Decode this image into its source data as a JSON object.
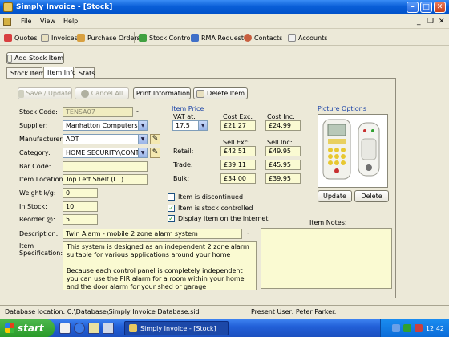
{
  "window": {
    "title": "Simply Invoice - [Stock]"
  },
  "menu": {
    "file": "File",
    "view": "View",
    "help": "Help"
  },
  "toolbar": {
    "quotes": "Quotes",
    "invoices": "Invoices",
    "purchase_orders": "Purchase Orders",
    "stock_control": "Stock Control",
    "rma": "RMA Request",
    "contacts": "Contacts",
    "accounts": "Accounts"
  },
  "add_stock_item": "Add Stock Item",
  "tabs": {
    "stock_items": "Stock Items",
    "item_info": "Item Info",
    "stats": "Stats"
  },
  "actions": {
    "save": "Save / Update",
    "cancel": "Cancel All",
    "print": "Print Information",
    "delete": "Delete Item"
  },
  "labels": {
    "stock_code": "Stock Code:",
    "supplier": "Supplier:",
    "manufacturer": "Manufacturer:",
    "category": "Category:",
    "bar_code": "Bar Code:",
    "item_location": "Item Location:",
    "weight": "Weight k/g:",
    "in_stock": "In Stock:",
    "reorder": "Reorder @:",
    "description": "Description:",
    "specification": "Item Specification:"
  },
  "values": {
    "stock_code": "TENSA07",
    "supplier": "Manhatton Computers",
    "manufacturer": "ADT",
    "category": "HOME SECURITY\\CONT",
    "bar_code": "",
    "item_location": "Top Left Shelf (L1)",
    "weight": "0",
    "in_stock": "10",
    "reorder": "5",
    "description": "Twin Alarm - mobile 2 zone alarm system",
    "spec_p1": "This system is designed as an independent 2 zone alarm suitable for various applications around your home",
    "spec_p2": "Because each control panel is completely independent you can use the PIR alarm for a room within your home and the door alarm for your shed or garage"
  },
  "price": {
    "group": "Item Price",
    "vat_label": "VAT at:",
    "vat_value": "17.5",
    "cost_exc_label": "Cost Exc:",
    "cost_inc_label": "Cost Inc:",
    "cost_exc": "£21.27",
    "cost_inc": "£24.99",
    "sell_exc_label": "Sell Exc:",
    "sell_inc_label": "Sell Inc:",
    "retail_label": "Retail:",
    "trade_label": "Trade:",
    "bulk_label": "Bulk:",
    "retail_exc": "£42.51",
    "retail_inc": "£49.95",
    "trade_exc": "£39.11",
    "trade_inc": "£45.95",
    "bulk_exc": "£34.00",
    "bulk_inc": "£39.95"
  },
  "options": {
    "discontinued": "Item is discontinued",
    "stock_controlled": "Item is stock controlled",
    "display_internet": "Display item on the internet",
    "discontinued_checked": false,
    "stock_controlled_checked": true,
    "display_internet_checked": true
  },
  "picture": {
    "group": "Picture Options",
    "update": "Update",
    "delete": "Delete"
  },
  "notes": {
    "label": "Item Notes:",
    "value": ""
  },
  "status": {
    "db_location": "Database location: C:\\Database\\Simply Invoice Database.sid",
    "user": "Present User: Peter Parker."
  },
  "taskbar": {
    "start": "start",
    "task": "Simply Invoice - [Stock]",
    "clock": "12:42"
  },
  "colors": {
    "field_bg": "#fafad2",
    "titlebar": "#0a5fd8",
    "group_title": "#1c44a8"
  }
}
